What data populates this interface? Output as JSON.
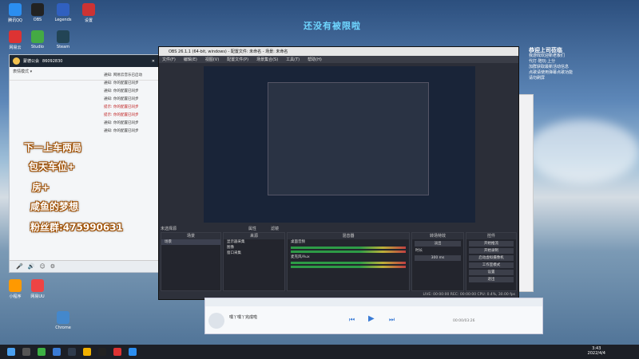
{
  "desktop": {
    "banner_text": "还没有被限啦",
    "icons": [
      {
        "label": "腾讯QQ",
        "color": "#2b8ef0"
      },
      {
        "label": "OBS",
        "color": "#222"
      },
      {
        "label": "Legends",
        "color": "#3060c0"
      },
      {
        "label": "设置",
        "color": "#c33"
      },
      {
        "label": "网易云",
        "color": "#d33"
      },
      {
        "label": "Studio",
        "color": "#4a4"
      },
      {
        "label": "Steam",
        "color": "#245"
      },
      {
        "label": "小程序",
        "color": "#f90"
      },
      {
        "label": "网易UU",
        "color": "#e44"
      },
      {
        "label": "Chrome",
        "color": "#48c"
      }
    ]
  },
  "qq": {
    "title": "蒙德公会",
    "group_id": "86092830",
    "sub_label": "表情模式 ▾",
    "messages": [
      {
        "text": "通知: 网易云音乐已启动",
        "red": false
      },
      {
        "text": "通知: 你的配置已同步",
        "red": false
      },
      {
        "text": "通知: 你的配置已同步",
        "red": false
      },
      {
        "text": "通知: 你的配置已同步",
        "red": false
      },
      {
        "text": "提示: 你的配置已同步",
        "red": true
      },
      {
        "text": "提示: 你的配置已同步",
        "red": true
      },
      {
        "text": "通知: 你的配置已同步",
        "red": false
      },
      {
        "text": "通知: 你的配置已同步",
        "red": false
      }
    ]
  },
  "overlay": {
    "line1": "下一上车两局",
    "line2": "包天车位+",
    "line3": "房+",
    "line4": "咸鱼的梦想",
    "line5": "粉丝群:475990631"
  },
  "obs": {
    "window_title": "OBS 26.1.1 (64-bit, windows) - 配置文件: 未命名 - 场景: 未命名",
    "menu": [
      "文件(F)",
      "编辑(E)",
      "视图(V)",
      "配置文件(P)",
      "场景集合(S)",
      "工具(T)",
      "帮助(H)"
    ],
    "no_source": "未选择源",
    "props": "属性",
    "filters": "滤镜",
    "scene_header": "场景",
    "scene_item": "场景",
    "sources_header": "来源",
    "sources": [
      "显示器采集",
      "图像",
      "窗口采集"
    ],
    "mixer_header": "混音器",
    "mixer_tracks": [
      "桌面音频",
      "麦克风/Aux"
    ],
    "transition_header": "转场特效",
    "transition_value": "淡出",
    "duration_label": "时长",
    "duration_value": "300 ms",
    "controls_header": "控件",
    "controls": [
      "开始推流",
      "开始录制",
      "启动虚拟摄像机",
      "工作室模式",
      "设置",
      "退出"
    ],
    "status": "LIVE: 00:00:00   REC: 00:00:00   CPU: 0.4%, 30.00 fps"
  },
  "player": {
    "song": "嘿丫嘿丫完成啦",
    "time": "00:00/03:26"
  },
  "right": {
    "title": "恭迎上司莅临",
    "lines": [
      "我游戏欢迎新老板们",
      "代打·陪玩·上分",
      "加群获取最新活动信息",
      "点歌请使用弹幕点歌功能",
      "请勿刷屏"
    ]
  },
  "taskbar": {
    "time": "3:43",
    "date": "2022/4/4"
  }
}
